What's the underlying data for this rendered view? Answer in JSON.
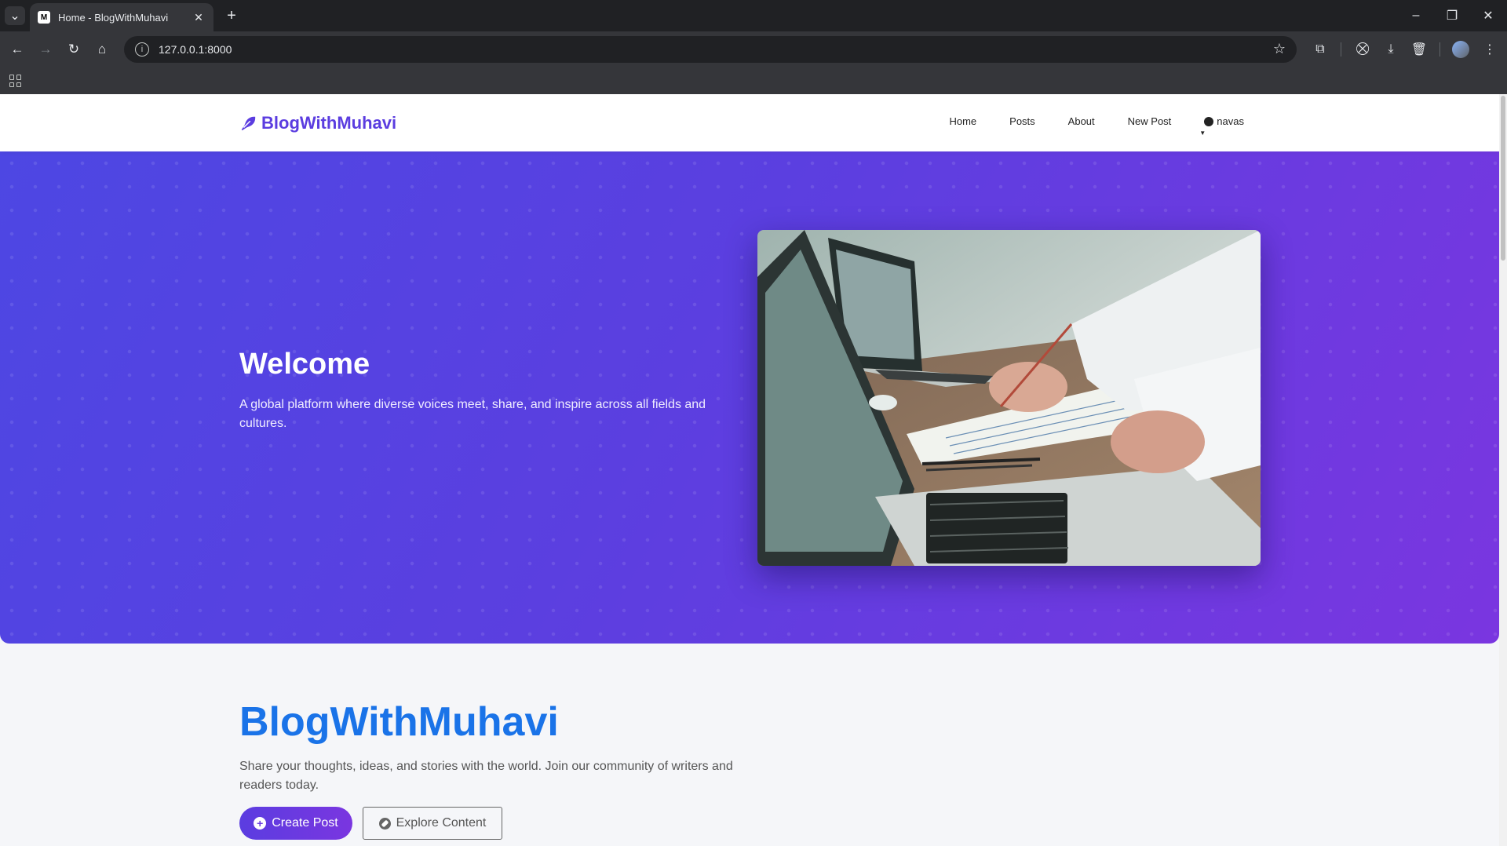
{
  "browser": {
    "tab_title": "Home - BlogWithMuhavi",
    "favicon_letter": "M",
    "url": "127.0.0.1:8000"
  },
  "site": {
    "brand": "BlogWithMuhavi",
    "nav": {
      "home": "Home",
      "posts": "Posts",
      "about": "About",
      "new_post": "New Post",
      "user": "navas"
    }
  },
  "hero": {
    "title": "Welcome",
    "subtitle": "A global platform where diverse voices meet, share, and inspire across all fields and cultures."
  },
  "intro": {
    "title": "BlogWithMuhavi",
    "text": "Share your thoughts, ideas, and stories with the world. Join our community of writers and readers today.",
    "create_label": "Create Post",
    "explore_label": "Explore Content"
  },
  "colors": {
    "brand": "#5b3de0",
    "hero_start": "#4d47e3",
    "hero_end": "#7a36e0",
    "intro_title": "#1a73e8"
  },
  "icons": {
    "brand": "feather-icon",
    "user": "user-circle-icon",
    "create": "plus-circle-icon",
    "explore": "compass-icon"
  }
}
